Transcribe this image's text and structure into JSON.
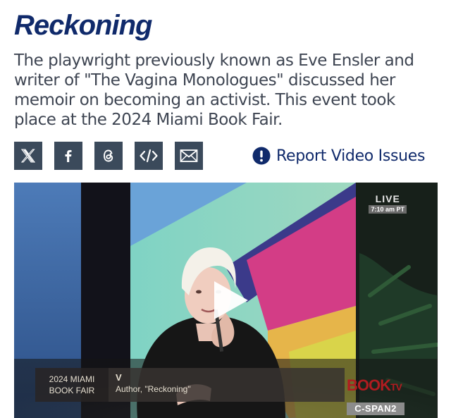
{
  "header": {
    "title": "Reckoning",
    "description": "The playwright previously known as Eve Ensler and writer of \"The Vagina Monologues\" discussed her memoir on becoming an activist. This event took place at the 2024 Miami Book Fair."
  },
  "share": {
    "buttons": [
      {
        "icon": "x-icon",
        "label": "X"
      },
      {
        "icon": "facebook-icon",
        "label": "f"
      },
      {
        "icon": "threads-icon",
        "label": "Threads"
      },
      {
        "icon": "embed-icon",
        "label": "</>"
      },
      {
        "icon": "email-icon",
        "label": "Email"
      }
    ]
  },
  "report": {
    "label": "Report Video Issues",
    "icon": "exclamation-icon"
  },
  "video": {
    "live_label": "LIVE",
    "live_time": "7:10 am PT",
    "lower_third": {
      "event_line1": "2024 MIAMI",
      "event_line2": "BOOK FAIR",
      "speaker_name": "V",
      "speaker_role": "Author, \"Reckoning\""
    },
    "network_brand": "BOOK",
    "network_brand_suffix": "TV",
    "channel_prefix": "C-SPAN",
    "channel_number": "2"
  },
  "colors": {
    "title": "#102a6b",
    "share_button_bg": "#3b4a5b",
    "report_text": "#102a6b",
    "booktv_red": "#b01c20"
  }
}
